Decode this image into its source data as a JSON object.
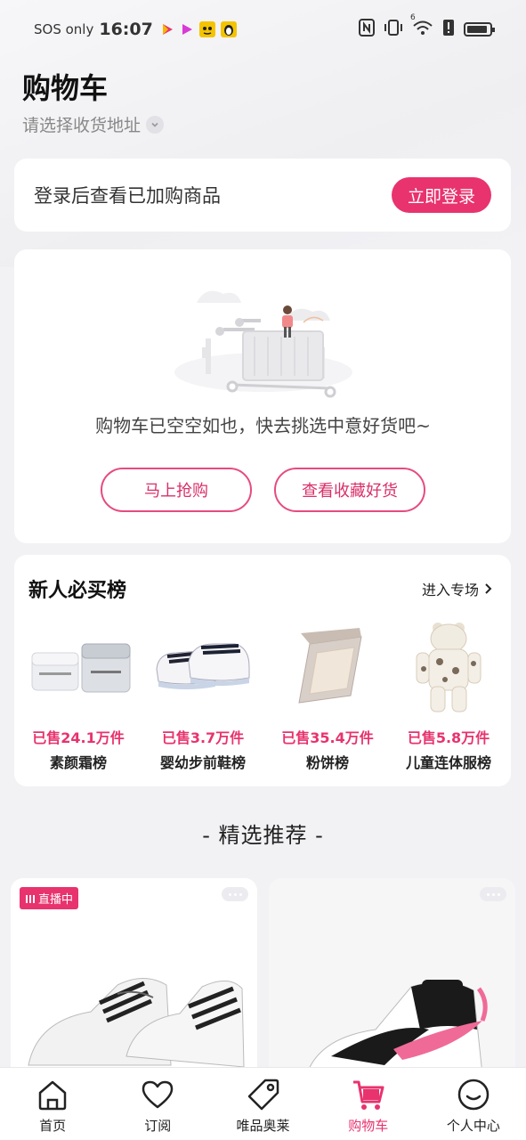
{
  "status_bar": {
    "carrier": "SOS only",
    "time": "16:07",
    "network": "6"
  },
  "header": {
    "title": "购物车",
    "address_prompt": "请选择收货地址"
  },
  "login_banner": {
    "text": "登录后查看已加购商品",
    "button": "立即登录"
  },
  "empty_cart": {
    "message": "购物车已空空如也，快去挑选中意好货吧~",
    "buttons": [
      "马上抢购",
      "查看收藏好货"
    ]
  },
  "ranking": {
    "title": "新人必买榜",
    "more": "进入专场",
    "items": [
      {
        "sold": "已售24.1万件",
        "name": "素颜霜榜",
        "icon": "cream-jars-image"
      },
      {
        "sold": "已售3.7万件",
        "name": "婴幼步前鞋榜",
        "icon": "baby-shoes-image"
      },
      {
        "sold": "已售35.4万件",
        "name": "粉饼榜",
        "icon": "powder-compact-image"
      },
      {
        "sold": "已售5.8万件",
        "name": "儿童连体服榜",
        "icon": "kids-jumpsuit-image"
      }
    ]
  },
  "recommend": {
    "title": "精选推荐",
    "products": [
      {
        "badge": "直播中",
        "icon": "white-sneakers-image"
      },
      {
        "badge": "",
        "icon": "pink-black-sneaker-image"
      }
    ]
  },
  "tabbar": {
    "items": [
      {
        "label": "首页",
        "icon": "home-icon"
      },
      {
        "label": "订阅",
        "icon": "heart-icon"
      },
      {
        "label": "唯品奥莱",
        "icon": "tag-icon"
      },
      {
        "label": "购物车",
        "icon": "cart-icon"
      },
      {
        "label": "个人中心",
        "icon": "smile-icon"
      }
    ],
    "active": "购物车"
  },
  "colors": {
    "accent": "#e8336e",
    "background": "#f2f2f5"
  }
}
